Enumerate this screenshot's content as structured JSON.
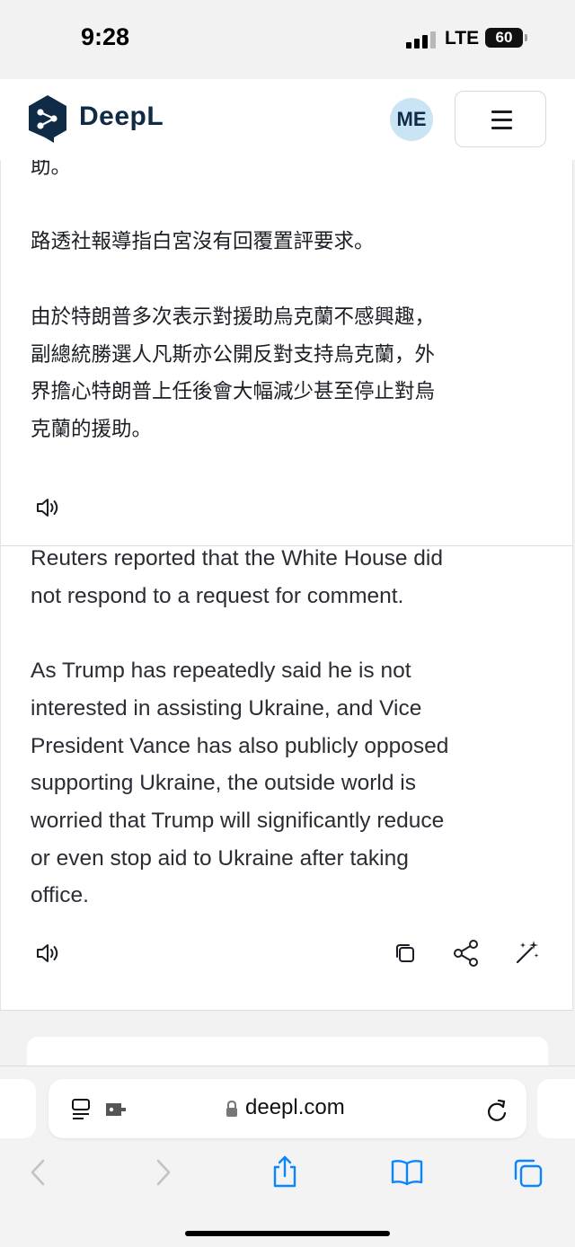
{
  "status_bar": {
    "time": "9:28",
    "network": "LTE",
    "battery": "60"
  },
  "header": {
    "brand": "DeepL",
    "avatar_initials": "ME",
    "brand_color": "#0f2b46",
    "avatar_bg": "#c8e4f5"
  },
  "source": {
    "paragraphs": [
      "助。",
      "路透社報導指白宮沒有回覆置評要求。",
      "由於特朗普多次表示對援助烏克蘭不感興趣，\n副總統勝選人凡斯亦公開反對支持烏克蘭，外\n界擔心特朗普上任後會大幅減少甚至停止對烏\n克蘭的援助。"
    ],
    "icons": [
      "speaker-icon"
    ]
  },
  "target": {
    "paragraphs": [
      "Reuters reported that the White House did\nnot respond to a request for comment.",
      "As Trump has repeatedly said he is not\ninterested in assisting Ukraine, and Vice\nPresident Vance has also publicly opposed\nsupporting Ukraine, the outside world is\nworried that Trump will significantly reduce\nor even stop aid to Ukraine after taking\noffice."
    ],
    "icons": [
      "speaker-icon",
      "copy-icon",
      "share-icon",
      "improve-icon"
    ]
  },
  "browser": {
    "url": "deepl.com",
    "icons": [
      "page-menu-icon",
      "extension-icon",
      "lock-icon",
      "reload-icon",
      "back-icon",
      "forward-icon",
      "share-icon",
      "bookmarks-icon",
      "tabs-icon"
    ],
    "accent": "#0a84ff"
  }
}
